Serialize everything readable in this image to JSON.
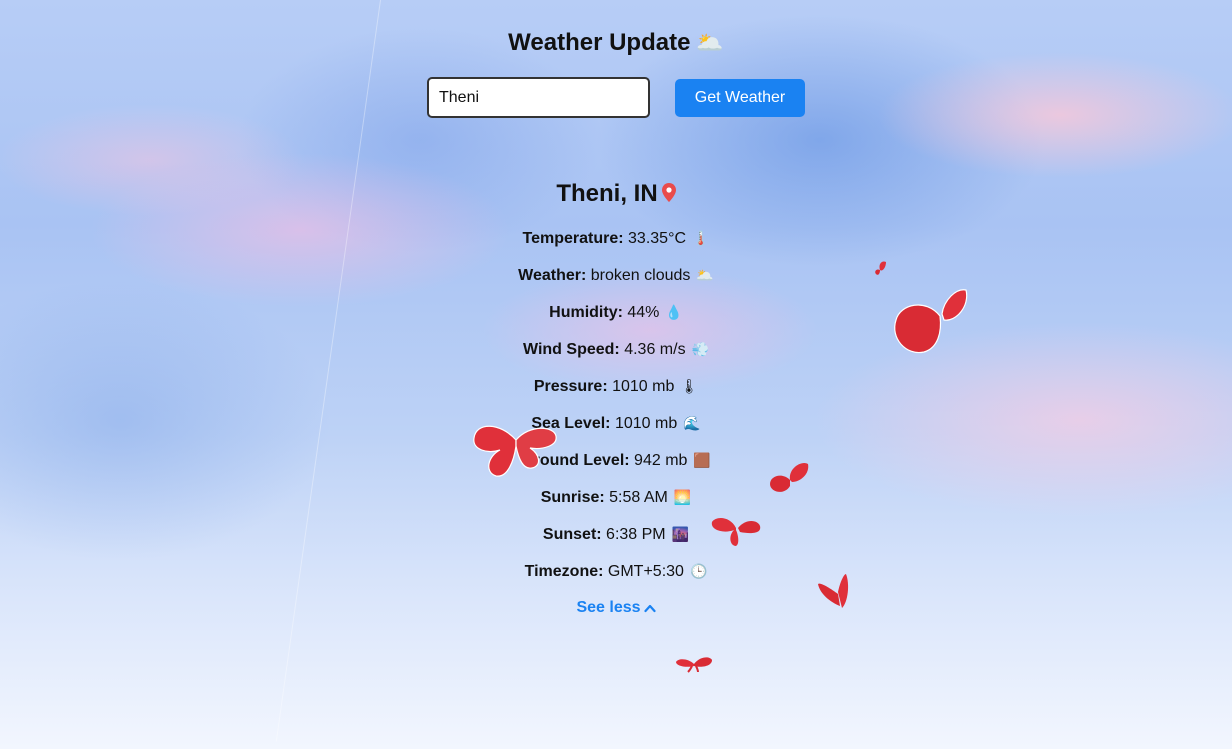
{
  "header": {
    "title": "Weather Update",
    "title_icon": "🌥️"
  },
  "search": {
    "value": "Theni",
    "button_label": "Get Weather"
  },
  "location": {
    "name": "Theni, IN",
    "icon": "map-pin-icon"
  },
  "details": [
    {
      "label": "Temperature:",
      "value": "33.35°C",
      "icon": "🌡️",
      "icon_name": "thermometer-icon"
    },
    {
      "label": "Weather:",
      "value": "broken clouds",
      "icon": "🌥️",
      "icon_name": "cloud-sun-icon"
    },
    {
      "label": "Humidity:",
      "value": "44%",
      "icon": "💧",
      "icon_name": "droplet-icon"
    },
    {
      "label": "Wind Speed:",
      "value": "4.36 m/s",
      "icon": "💨",
      "icon_name": "wind-icon"
    },
    {
      "label": "Pressure:",
      "value": "1010 mb",
      "icon": "🌡",
      "icon_name": "thermometer-icon"
    },
    {
      "label": "Sea Level:",
      "value": "1010 mb",
      "icon": "🌊",
      "icon_name": "wave-icon"
    },
    {
      "label": "Ground Level:",
      "value": "942 mb",
      "icon": "🟫",
      "icon_name": "ground-icon"
    },
    {
      "label": "Sunrise:",
      "value": "5:58 AM",
      "icon": "🌅",
      "icon_name": "sunrise-icon"
    },
    {
      "label": "Sunset:",
      "value": "6:38 PM",
      "icon": "🌆",
      "icon_name": "sunset-icon"
    },
    {
      "label": "Timezone:",
      "value": "GMT+5:30",
      "icon": "🕒",
      "icon_name": "clock-icon"
    }
  ],
  "toggle": {
    "label": "See less",
    "icon": "chevron-up-icon"
  },
  "colors": {
    "accent": "#1a82f2",
    "butterfly": "#e0303a",
    "pin": "#e94b4b"
  }
}
